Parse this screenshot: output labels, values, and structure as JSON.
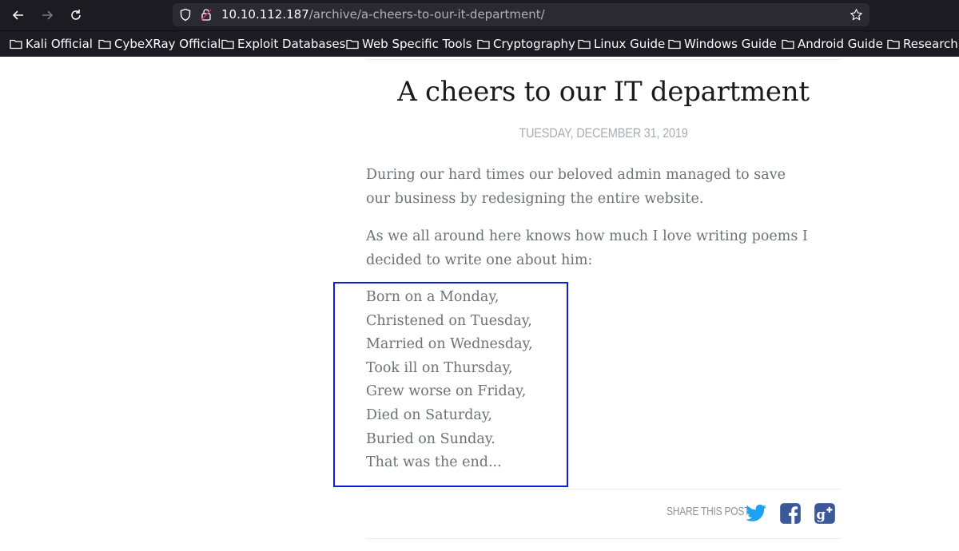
{
  "browser": {
    "url_host": "10.10.112.187",
    "url_path": "/archive/a-cheers-to-our-it-department/",
    "icons": {
      "back": "arrow-left-icon",
      "forward": "arrow-right-icon",
      "reload": "reload-icon",
      "shield": "shield-icon",
      "lock": "insecure-lock-icon",
      "bookmark_star": "star-icon"
    }
  },
  "bookmarks": [
    {
      "label": "Kali Official"
    },
    {
      "label": "CybeXRay Official"
    },
    {
      "label": "Exploit Databases"
    },
    {
      "label": "Web Specific Tools"
    },
    {
      "label": "Cryptography"
    },
    {
      "label": "Linux Guide"
    },
    {
      "label": "Windows Guide"
    },
    {
      "label": "Android Guide"
    },
    {
      "label": "Research"
    }
  ],
  "post": {
    "title": "A cheers to our IT department",
    "date": "TUESDAY, DECEMBER 31, 2019",
    "paragraphs": [
      "During our hard times our beloved admin managed to save our business by redesigning the entire website.",
      "As we all around here knows how much I love writing poems I decided to write one about him:"
    ],
    "poem": [
      "Born on a Monday,",
      "Christened on Tuesday,",
      "Married on Wednesday,",
      "Took ill on Thursday,",
      "Grew worse on Friday,",
      "Died on Saturday,",
      "Buried on Sunday.",
      "That was the end..."
    ]
  },
  "share": {
    "label": "SHARE THIS POST",
    "networks": [
      "twitter-icon",
      "facebook-icon",
      "google-plus-icon"
    ],
    "colors": {
      "twitter": "#1da1f2",
      "facebook": "#3b5998",
      "googleplus": "#3b5998"
    }
  },
  "highlight_color": "#0b1fd6"
}
